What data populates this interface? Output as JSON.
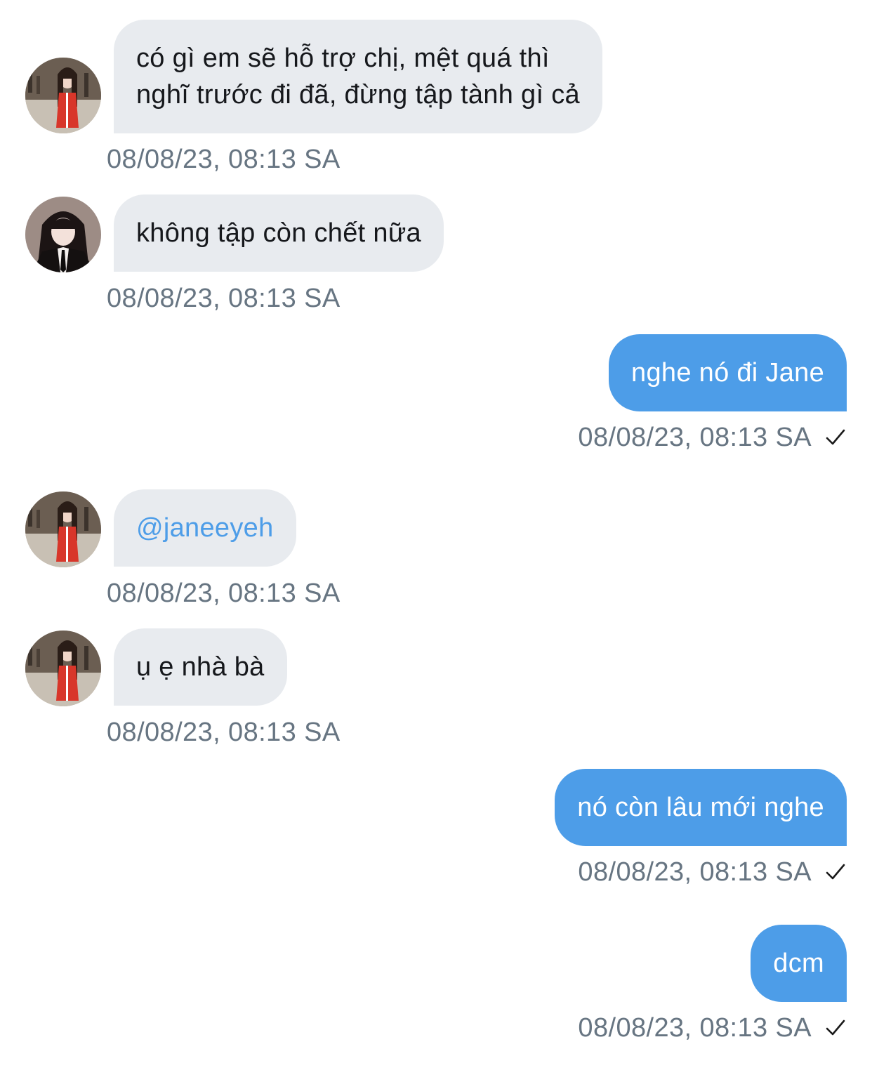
{
  "messages": [
    {
      "direction": "in",
      "sender_avatar": "avatar-girl-red-shirt",
      "lines": [
        "có gì em sẽ hỗ trợ chị, mệt quá thì",
        "nghĩ trước đi đã, đừng tập tành gì cả"
      ],
      "timestamp": "08/08/23, 08:13 SA"
    },
    {
      "direction": "in",
      "sender_avatar": "avatar-girl-suit",
      "text": "không tập còn chết nữa",
      "timestamp": "08/08/23, 08:13 SA"
    },
    {
      "direction": "out",
      "text": "nghe nó đi Jane",
      "timestamp": "08/08/23, 08:13 SA",
      "status_icon": "check-icon"
    },
    {
      "direction": "in",
      "sender_avatar": "avatar-girl-red-shirt",
      "text": "@janeeyeh",
      "timestamp": "08/08/23, 08:13 SA"
    },
    {
      "direction": "in",
      "sender_avatar": "avatar-girl-red-shirt",
      "text": "ụ ẹ nhà bà",
      "timestamp": "08/08/23, 08:13 SA"
    },
    {
      "direction": "out",
      "text": "nó còn lâu mới nghe",
      "timestamp": "08/08/23, 08:13 SA",
      "status_icon": "check-icon"
    },
    {
      "direction": "out",
      "text": "dcm",
      "timestamp": "08/08/23, 08:13 SA",
      "status_icon": "check-icon"
    }
  ],
  "colors": {
    "incoming_bubble": "#e8ebef",
    "outgoing_bubble": "#4d9de8",
    "timestamp": "#677582",
    "mention": "#4d9de8"
  }
}
